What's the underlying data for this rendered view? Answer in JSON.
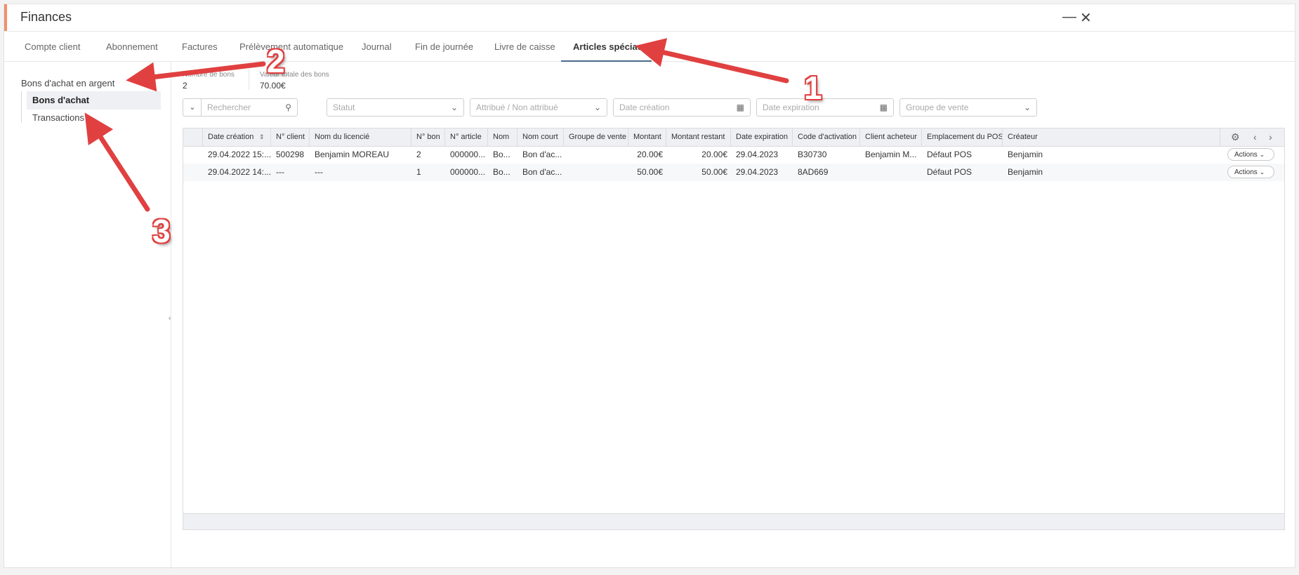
{
  "window": {
    "title": "Finances"
  },
  "tabs": [
    {
      "label": "Compte client"
    },
    {
      "label": "Abonnement"
    },
    {
      "label": "Factures"
    },
    {
      "label": "Prélèvement automatique"
    },
    {
      "label": "Journal"
    },
    {
      "label": "Fin de journée"
    },
    {
      "label": "Livre de caisse"
    },
    {
      "label": "Articles spéciaux"
    }
  ],
  "sidebar": {
    "group": "Bons d'achat en argent",
    "items": [
      {
        "label": "Bons d'achat"
      },
      {
        "label": "Transactions"
      }
    ]
  },
  "stats": [
    {
      "label": "Nombre de bons",
      "value": "2"
    },
    {
      "label": "Valeur totale des bons",
      "value": "70.00€"
    }
  ],
  "filters": {
    "search_placeholder": "Rechercher",
    "statut": "Statut",
    "attribue": "Attribué / Non attribué",
    "date_creation": "Date création",
    "date_expiration": "Date expiration",
    "groupe_vente": "Groupe de vente"
  },
  "table": {
    "columns": [
      "Date création",
      "N° client",
      "Nom du licencié",
      "N° bon",
      "N° article",
      "Nom",
      "Nom court",
      "Groupe de vente",
      "Montant",
      "Montant restant",
      "Date expiration",
      "Code d'activation",
      "Client acheteur",
      "Emplacement du POS",
      "Créateur"
    ],
    "rows": [
      [
        "29.04.2022 15:...",
        "500298",
        "Benjamin MOREAU",
        "2",
        "000000...",
        "Bo...",
        "Bon d'ac...",
        "",
        "20.00€",
        "20.00€",
        "29.04.2023",
        "B30730",
        "Benjamin M...",
        "Défaut POS",
        "Benjamin"
      ],
      [
        "29.04.2022 14:...",
        "---",
        "---",
        "1",
        "000000...",
        "Bo...",
        "Bon d'ac...",
        "",
        "50.00€",
        "50.00€",
        "29.04.2023",
        "8AD669",
        "",
        "Défaut POS",
        "Benjamin"
      ]
    ],
    "action_label": "Actions"
  },
  "annotations": [
    "1",
    "2",
    "3"
  ],
  "colors": {
    "accent": "#f0906a",
    "annotation": "#e04040",
    "tab_underline": "#4a6a8a"
  }
}
